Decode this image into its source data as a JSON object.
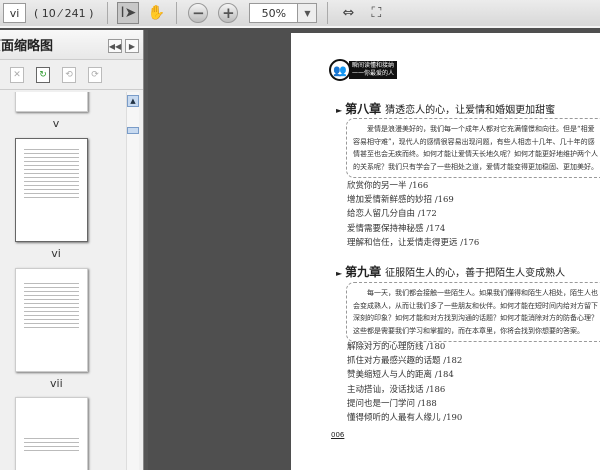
{
  "toolbar": {
    "page_input": "vi",
    "page_count": "( 10 ⁄ 241 )",
    "zoom": "50%",
    "icons": [
      "select-tool-icon",
      "hand-tool-icon",
      "zoom-out-icon",
      "zoom-in-icon",
      "fit-width-icon",
      "fit-page-icon"
    ]
  },
  "panel": {
    "title": "页面缩略图",
    "prev": "◀◀",
    "next": "▶",
    "thumbnails": [
      {
        "label": "v"
      },
      {
        "label": "vi"
      },
      {
        "label": "vii"
      }
    ]
  },
  "page": {
    "logo_text": [
      "瞬间读懂和接纳",
      "一一你最爱的人"
    ],
    "chapters": [
      {
        "number": "第八章",
        "title": "猜透恋人的心，让爱情和婚姻更加甜蜜",
        "intro": "爱情是浪漫美好的，我们每一个成年人都对它充满憧憬和向往。但是“相爱容易相守难”，现代人的感情很容易出现问题，有些人相恋十几年、几十年的感情甚至也会无疾而终。如何才能让爱情天长地久呢？如何才能更好地维护两个人的关系呢？我们只有学会了一些相处之道，爱情才能变得更加稳固、更加美好。",
        "items": [
          "欣赏你的另一半 /166",
          "增加爱情新鲜感的妙招 /169",
          "给恋人留几分自由 /172",
          "爱情需要保持神秘感 /174",
          "理解和信任，让爱情走得更远 /176"
        ]
      },
      {
        "number": "第九章",
        "title": "征服陌生人的心，善于把陌生人变成熟人",
        "intro": "每一天，我们都会接触一些陌生人。如果我们懂得和陌生人相处，陌生人也会变成熟人，从而让我们多了一些朋友和伙伴。如何才能在短时间内给对方留下深刻的印象？如何才能和对方找到沟通的话题？如何才能消除对方的防备心理？这些都是需要我们学习和掌握的，而在本章里，你将会找到你想要的答案。",
        "items": [
          "解除对方的心理防线 /180",
          "抓住对方最感兴趣的话题 /182",
          "赞美缩短人与人的距离 /184",
          "主动搭讪，没话找话 /186",
          "提问也是一门学问 /188",
          "懂得倾听的人最有人缘儿 /190"
        ]
      }
    ],
    "page_number": "006"
  }
}
